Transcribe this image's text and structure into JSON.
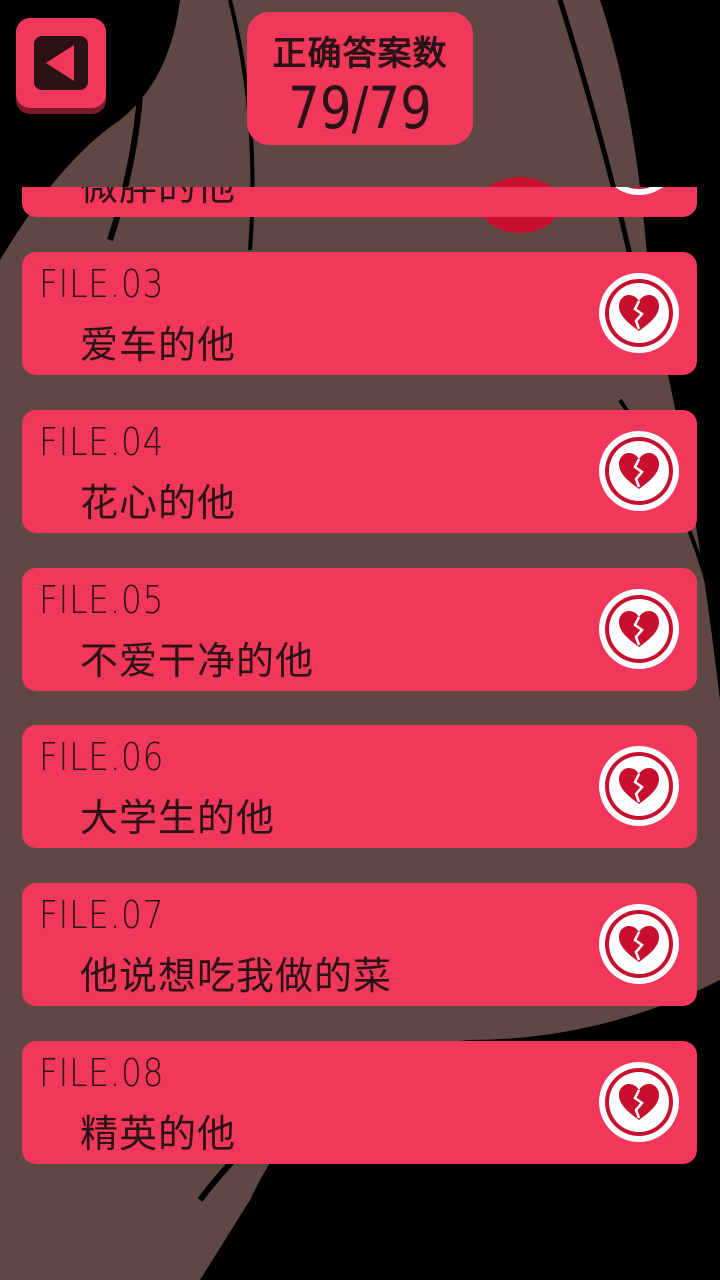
{
  "header": {
    "score_label": "正确答案数",
    "score_value": "79/79"
  },
  "files": [
    {
      "number": "",
      "title": "微胖的他",
      "status_icon": "broken-heart-icon"
    },
    {
      "number": "FILE.03",
      "title": "爱车的他",
      "status_icon": "broken-heart-icon"
    },
    {
      "number": "FILE.04",
      "title": "花心的他",
      "status_icon": "broken-heart-icon"
    },
    {
      "number": "FILE.05",
      "title": "不爱干净的他",
      "status_icon": "broken-heart-icon"
    },
    {
      "number": "FILE.06",
      "title": "大学生的他",
      "status_icon": "broken-heart-icon"
    },
    {
      "number": "FILE.07",
      "title": "他说想吃我做的菜",
      "status_icon": "broken-heart-icon"
    },
    {
      "number": "FILE.08",
      "title": "精英的他",
      "status_icon": "broken-heart-icon"
    }
  ],
  "colors": {
    "accent": "#f2385a",
    "text": "#2a1216",
    "background_skin": "#5f4744",
    "lips": "#c8102e"
  }
}
